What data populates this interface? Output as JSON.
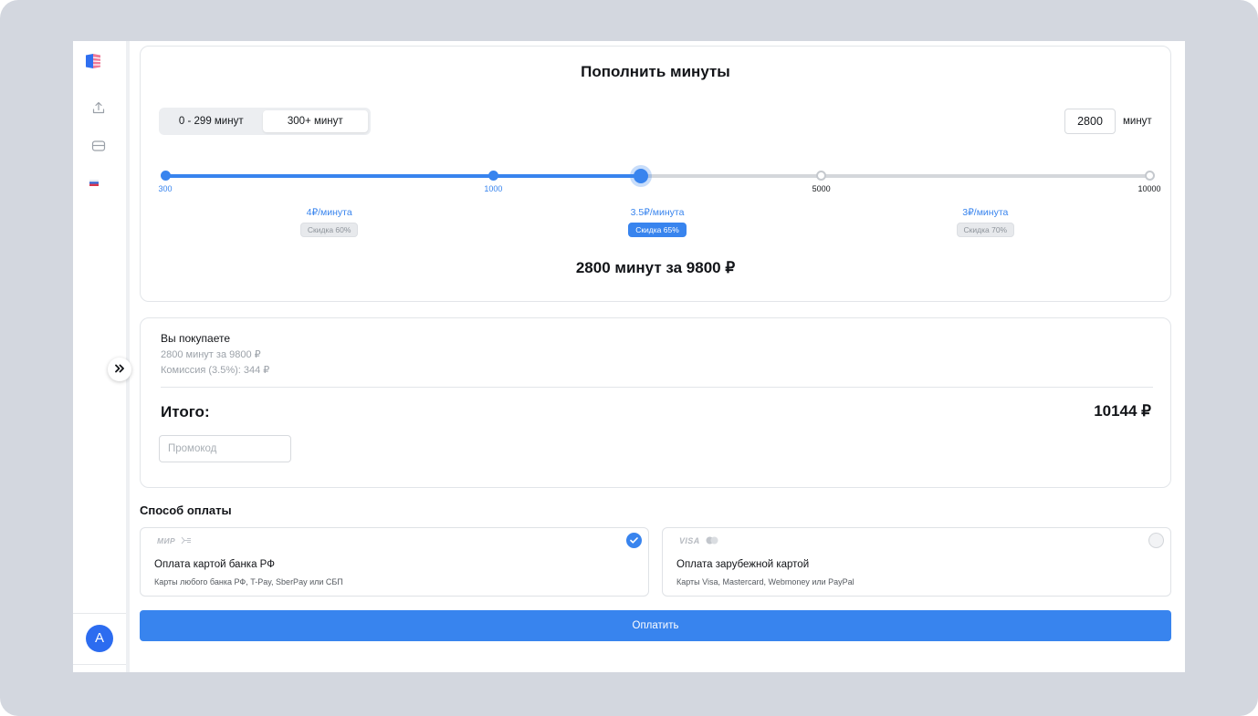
{
  "colors": {
    "accent": "#3884ee",
    "page_bg": "#d3d7df",
    "avatar": "#2c6cf0"
  },
  "sidebar": {
    "icons": [
      "logo-icon",
      "upload-icon",
      "box-icon",
      "flag-ru-icon"
    ],
    "expand_icon": "chevrons-right-icon",
    "avatar_initial": "A"
  },
  "topup": {
    "title": "Пополнить минуты",
    "tabs": [
      {
        "label": "0 - 299 минут",
        "active": false
      },
      {
        "label": "300+ минут",
        "active": true
      }
    ],
    "minutes_input_value": "2800",
    "minutes_unit": "минут",
    "slider": {
      "value": 2800,
      "marks": [
        {
          "value": 300,
          "label": "300"
        },
        {
          "value": 1000,
          "label": "1000"
        },
        {
          "value": 5000,
          "label": "5000"
        },
        {
          "value": 10000,
          "label": "10000"
        }
      ]
    },
    "tiers": [
      {
        "price": "4₽/минута",
        "discount": "Скидка 60%",
        "active": false
      },
      {
        "price": "3.5₽/минута",
        "discount": "Скидка 65%",
        "active": true
      },
      {
        "price": "3₽/минута",
        "discount": "Скидка 70%",
        "active": false
      }
    ],
    "summary": "2800 минут за 9800 ₽"
  },
  "order": {
    "heading": "Вы покупаете",
    "line_item": "2800 минут за 9800 ₽",
    "commission": "Комиссия (3.5%): 344 ₽",
    "total_label": "Итого:",
    "total_value": "10144 ₽",
    "promo_placeholder": "Промокод"
  },
  "payment": {
    "heading": "Способ оплаты",
    "methods": [
      {
        "brands": "МИР",
        "brand_icon": "sbp-icon",
        "title": "Оплата картой банка РФ",
        "subtitle": "Карты любого банка РФ, T-Pay, SberPay или СБП",
        "selected": true
      },
      {
        "brands": "VISA",
        "brand_icon": "mastercard-icon",
        "title": "Оплата зарубежной картой",
        "subtitle": "Карты Visa, Mastercard, Webmoney или PayPal",
        "selected": false
      }
    ],
    "pay_button": "Оплатить"
  }
}
